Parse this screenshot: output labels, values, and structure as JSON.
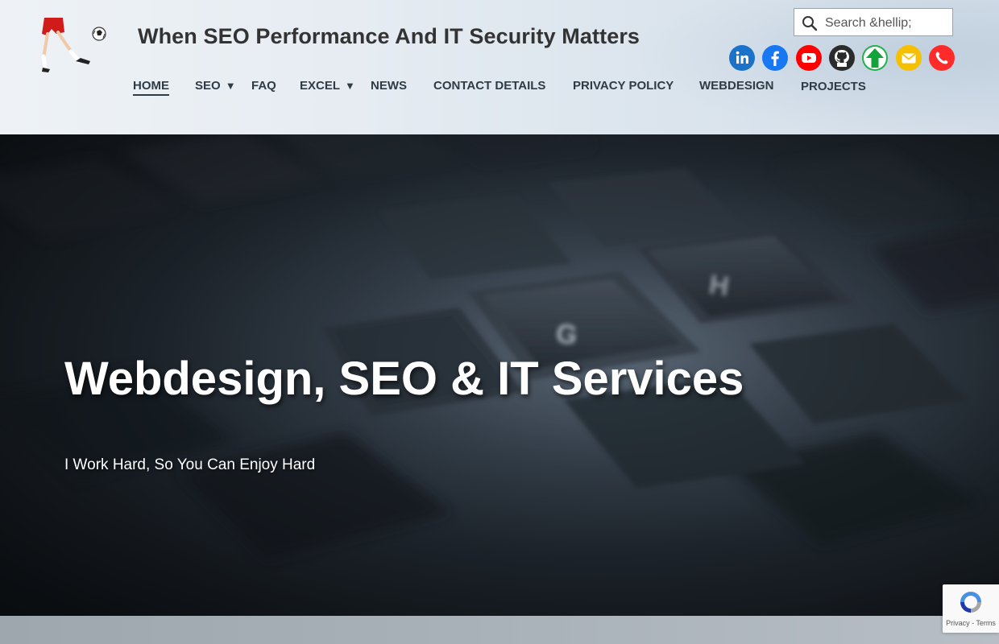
{
  "header": {
    "site_title": "When SEO Performance And IT Security Matters",
    "search": {
      "placeholder": "Search &hellip;"
    },
    "socials": [
      {
        "icon": "linkedin-icon",
        "color": "#1a73c8"
      },
      {
        "icon": "facebook-icon",
        "color": "#1877f2"
      },
      {
        "icon": "youtube-icon",
        "color": "#ff0000"
      },
      {
        "icon": "github-icon",
        "color": "#2b2b2b"
      },
      {
        "icon": "upload-arrow-icon",
        "color": "#22b14c"
      },
      {
        "icon": "email-icon",
        "color": "#f5c000"
      },
      {
        "icon": "phone-icon",
        "color": "#ff2b2b"
      }
    ],
    "nav": [
      {
        "label": "HOME",
        "active": true
      },
      {
        "label": "SEO",
        "has_dropdown": true,
        "caret": "▼"
      },
      {
        "label": "FAQ"
      },
      {
        "label": "EXCEL",
        "has_dropdown": true,
        "caret": "▼"
      },
      {
        "label": "NEWS"
      },
      {
        "label": "CONTACT DETAILS"
      },
      {
        "label": "PRIVACY POLICY"
      },
      {
        "label": "WEBDESIGN"
      },
      {
        "label": "PROJECTS"
      }
    ]
  },
  "hero": {
    "title": "Webdesign, SEO & IT Services",
    "subtitle": "I Work Hard, So You Can Enjoy Hard"
  },
  "recaptcha": {
    "links": "Privacy - Terms"
  }
}
